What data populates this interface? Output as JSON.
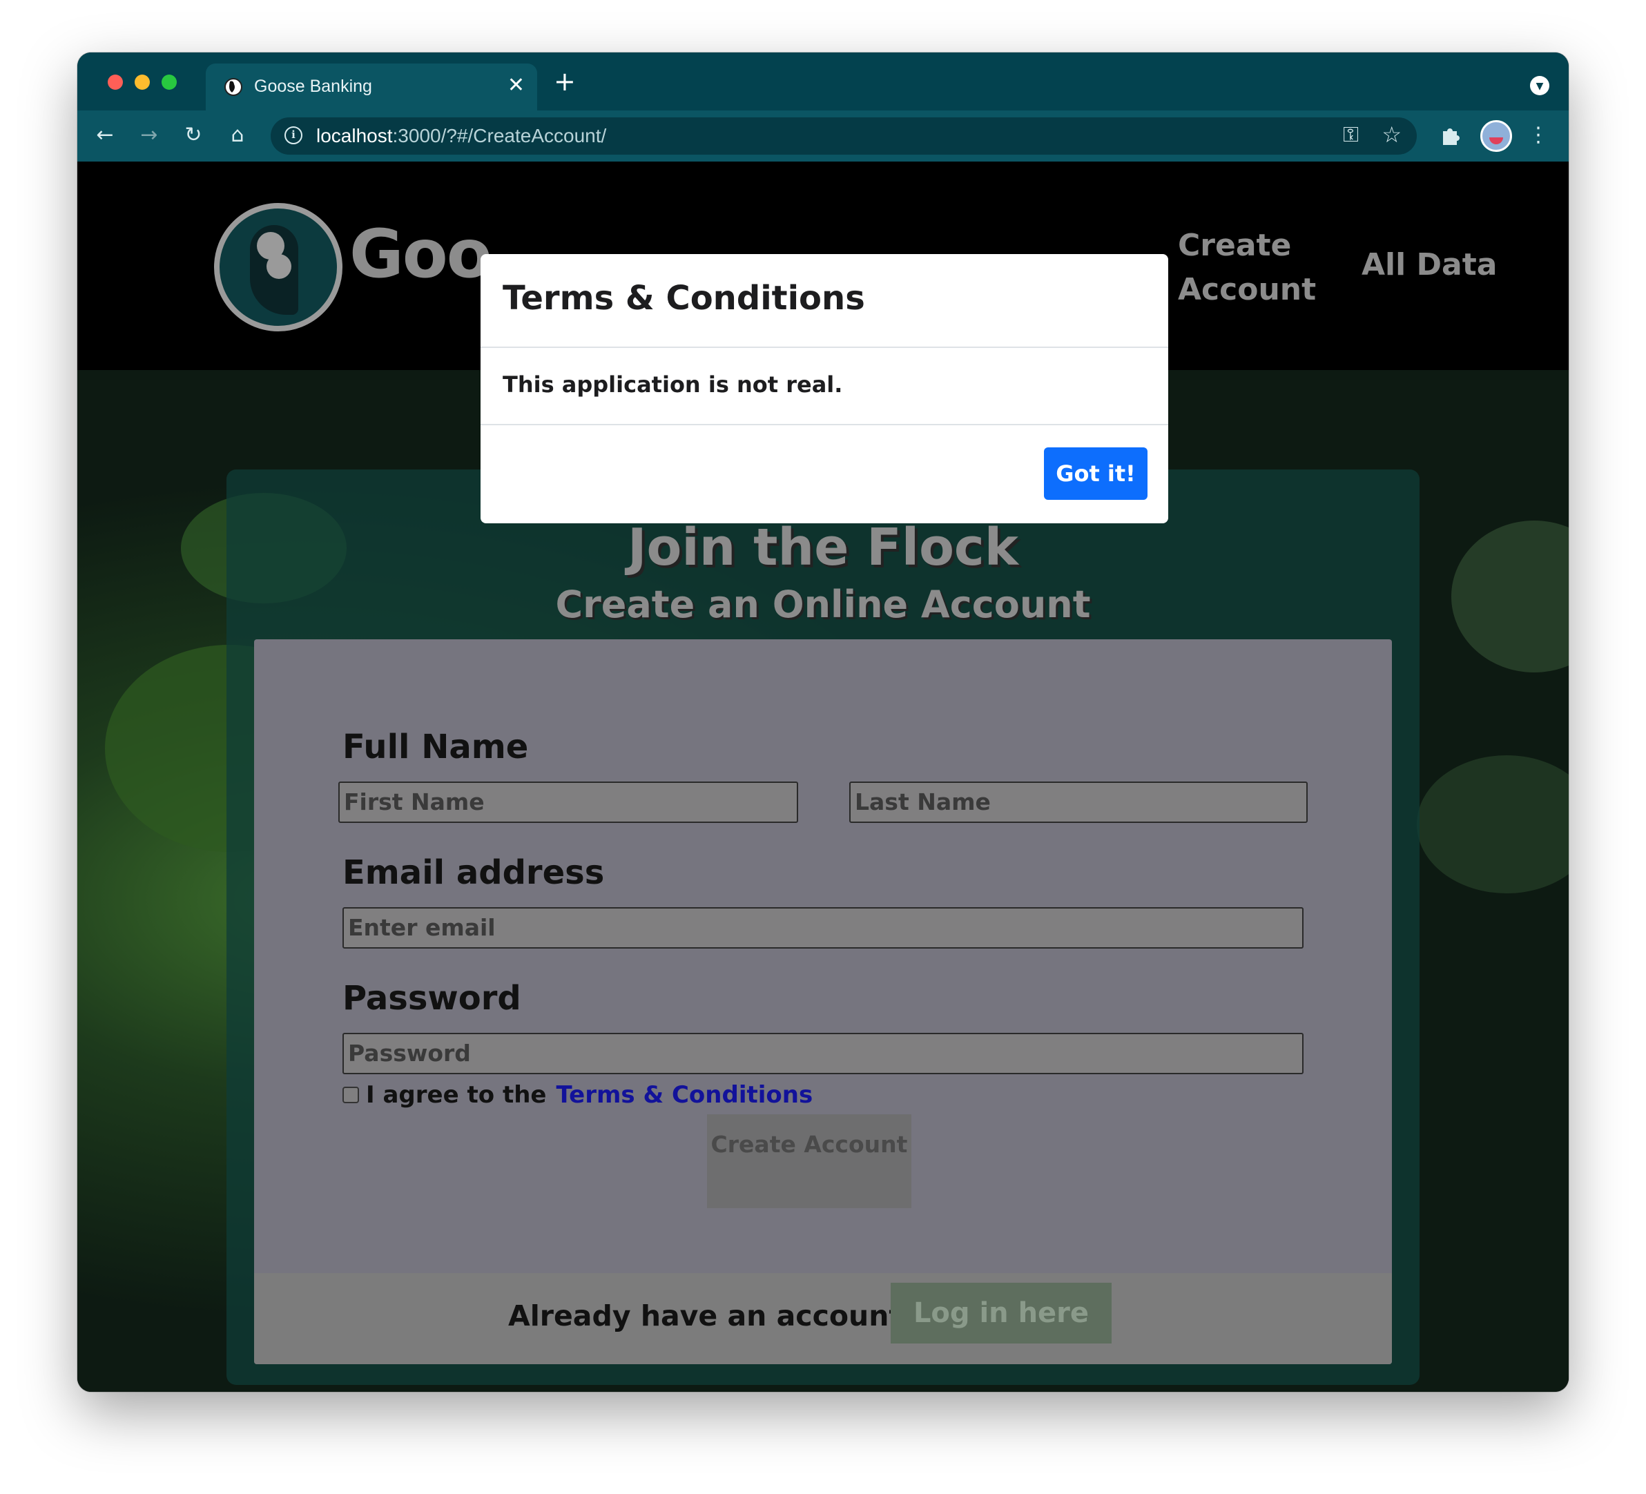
{
  "browser": {
    "tab_title": "Goose Banking",
    "tab_close": "✕",
    "new_tab": "+",
    "url_host": "localhost",
    "url_path": ":3000/?#/CreateAccount/"
  },
  "navbar": {
    "brand": "Goo",
    "links": [
      "Create Account",
      "All Data"
    ]
  },
  "card": {
    "title": "Join the Flock",
    "subtitle": "Create an Online Account"
  },
  "form": {
    "full_name_label": "Full Name",
    "first_name_placeholder": "First Name",
    "last_name_placeholder": "Last Name",
    "email_label": "Email address",
    "email_placeholder": "Enter email",
    "password_label": "Password",
    "password_placeholder": "Password",
    "agree_text": "I agree to the",
    "terms_link": "Terms & Conditions",
    "create_button": "Create Account",
    "already_text": "Already have an account?",
    "login_button": "Log in here"
  },
  "modal": {
    "title": "Terms & Conditions",
    "body": "This application is not real.",
    "button": "Got it!"
  },
  "colors": {
    "chrome": "#03424f",
    "primary_button": "#0d6efd",
    "link": "#12129a"
  }
}
